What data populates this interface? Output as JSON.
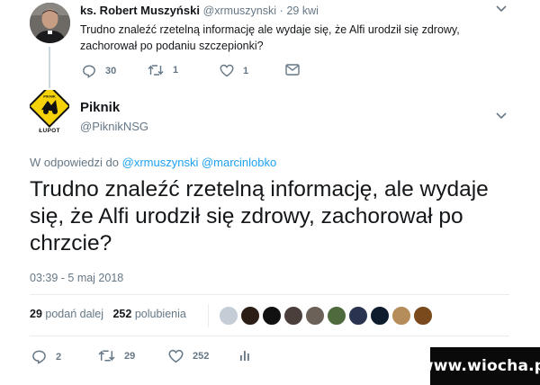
{
  "parent_tweet": {
    "author_name": "ks. Robert Muszyński",
    "author_handle": "@xrmuszynski",
    "separator": "·",
    "time": "29 kwi",
    "text": "Trudno znaleźć rzetelną informację ale wydaje się, że Alfi urodził się zdrowy, zachorował po podaniu szczepionki?",
    "actions": {
      "reply_count": "30",
      "retweet_count": "1",
      "like_count": "1"
    },
    "icons": [
      "reply-icon",
      "retweet-icon",
      "like-icon",
      "direct-message-icon",
      "chevron-down-icon"
    ]
  },
  "main_tweet": {
    "author_name": "Piknik",
    "author_handle": "@PiknikNSG",
    "avatar_label": "ŁUPOT",
    "reply_prefix": "W odpowiedzi do",
    "reply_mentions": "@xrmuszynski @marcinlobko",
    "text": "Trudno znaleźć rzetelną informację, ale wydaje się, że Alfi urodził się zdrowy, zachorował po chrzcie?",
    "timestamp": "03:39 - 5 maj 2018",
    "stats": {
      "retweets_count": "29",
      "retweets_label": "podań dalej",
      "likes_count": "252",
      "likes_label": "polubienia"
    },
    "actions": {
      "reply_count": "2",
      "retweet_count": "29",
      "like_count": "252"
    },
    "liker_avatar_count": 10,
    "icons": [
      "reply-icon",
      "retweet-icon",
      "like-icon",
      "analytics-icon",
      "chevron-down-icon"
    ]
  },
  "watermark": {
    "text": "www.wiocha.pl"
  },
  "colors": {
    "text_primary": "#14171a",
    "text_secondary": "#657786",
    "link_blue": "#1da1f2",
    "divider": "#e6ecf0",
    "avatar_yellow": "#f5d20a"
  }
}
